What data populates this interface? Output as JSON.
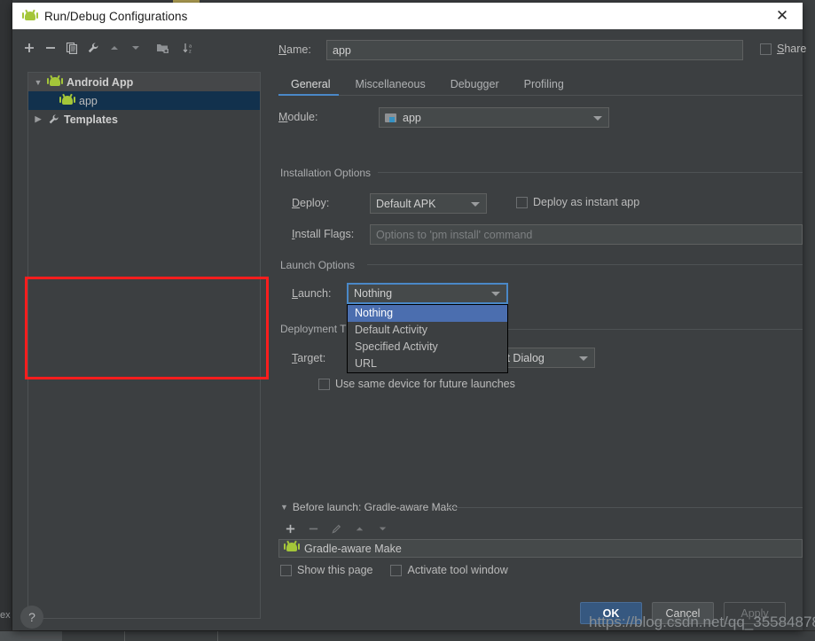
{
  "window": {
    "title": "Run/Debug Configurations",
    "close_label": "✕",
    "app_icon": "android-icon"
  },
  "tree_toolbar": [
    {
      "name": "add-button",
      "icon": "plus-icon",
      "label": "+"
    },
    {
      "name": "remove-button",
      "icon": "minus-icon",
      "label": "−"
    },
    {
      "name": "copy-button",
      "icon": "copy-icon",
      "label": "Copy Configuration"
    },
    {
      "name": "edit-templates-button",
      "icon": "wrench-icon",
      "label": "Edit Templates"
    },
    {
      "name": "move-up-button",
      "icon": "arrow-up-icon",
      "label": "Move Up"
    },
    {
      "name": "move-down-button",
      "icon": "arrow-down-icon",
      "label": "Move Down"
    },
    {
      "name": "new-folder-button",
      "icon": "folder-add-icon",
      "label": "Create New Folder"
    },
    {
      "name": "sort-button",
      "icon": "sort-az-icon",
      "label": "Sort Configurations"
    }
  ],
  "tree": {
    "nodes": [
      {
        "label": "Android App",
        "type": "group",
        "expanded": true,
        "icon": "android-icon",
        "twisty": "▼"
      },
      {
        "label": "app",
        "type": "child",
        "selected": true,
        "icon": "android-icon",
        "twisty": ""
      },
      {
        "label": "Templates",
        "type": "group",
        "expanded": false,
        "icon": "wrench-icon",
        "twisty": "▶"
      }
    ]
  },
  "form": {
    "name_label": "Name:",
    "name_value": "app",
    "share_label": "Share",
    "share_checked": false,
    "tabs": [
      {
        "label": "General",
        "active": true
      },
      {
        "label": "Miscellaneous",
        "active": false
      },
      {
        "label": "Debugger",
        "active": false
      },
      {
        "label": "Profiling",
        "active": false
      }
    ],
    "module_label": "Module:",
    "module_value": "app",
    "installation_options_title": "Installation Options",
    "deploy_label": "Deploy:",
    "deploy_value": "Default APK",
    "instant_app_label": "Deploy as instant app",
    "instant_app_checked": false,
    "install_flags_label": "Install Flags:",
    "install_flags_value": "",
    "install_flags_placeholder": "Options to 'pm install' command",
    "launch_options_title": "Launch Options",
    "launch_label": "Launch:",
    "launch_value": "Nothing",
    "launch_options": [
      {
        "label": "Nothing",
        "selected": true
      },
      {
        "label": "Default Activity",
        "selected": false
      },
      {
        "label": "Specified Activity",
        "selected": false
      },
      {
        "label": "URL",
        "selected": false
      }
    ],
    "deployment_target_title": "Deployment Target Options",
    "deployment_target_title_visible": "Deployment T",
    "target_label": "Target:",
    "target_value": "Open Select Deployment Target Dialog",
    "target_value_visible": "t Dialog",
    "same_device_label": "Use same device for future launches",
    "same_device_checked": false
  },
  "before_launch": {
    "title": "Before launch: Gradle-aware Make",
    "twisty": "▼",
    "toolbar": [
      {
        "name": "bl-add-button",
        "icon": "plus-icon"
      },
      {
        "name": "bl-remove-button",
        "icon": "minus-icon"
      },
      {
        "name": "bl-edit-button",
        "icon": "pencil-icon"
      },
      {
        "name": "bl-move-up-button",
        "icon": "arrow-up-icon"
      },
      {
        "name": "bl-move-down-button",
        "icon": "arrow-down-icon"
      }
    ],
    "items": [
      {
        "label": "Gradle-aware Make",
        "icon": "android-icon"
      }
    ],
    "show_page_label": "Show this page",
    "show_page_checked": false,
    "activate_tool_window_label": "Activate tool window",
    "activate_tool_window_checked": false
  },
  "footer": {
    "help_label": "?",
    "ok_label": "OK",
    "cancel_label": "Cancel",
    "apply_label": "Apply"
  },
  "watermark": "https://blog.csdn.net/qq_35584878",
  "background": {
    "edge_text": "ex"
  },
  "colors": {
    "accent_blue": "#4a88c7",
    "selection_blue": "#4b6eaf",
    "tree_selection": "#12314d",
    "ok_button": "#365880",
    "annotation_red": "#fc1d1d",
    "android_green": "#a4c639",
    "dialog_bg": "#3c3f41",
    "field_bg": "#45494a"
  }
}
